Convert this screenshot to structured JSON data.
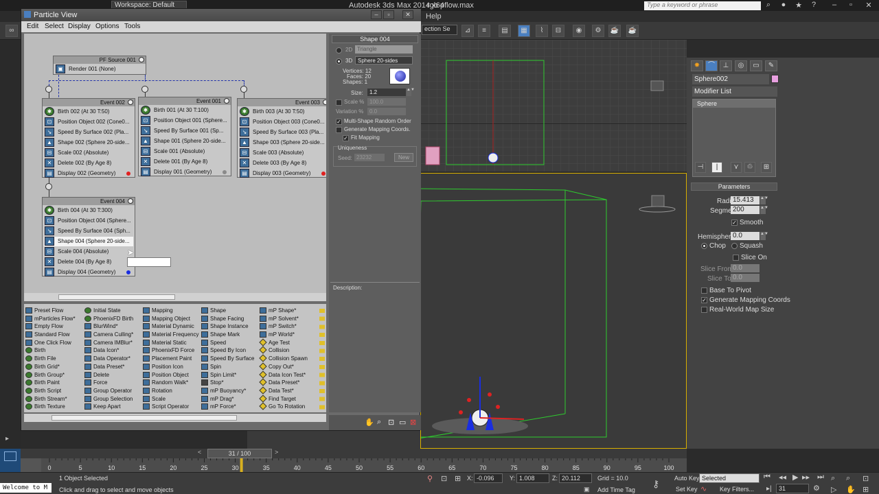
{
  "max": {
    "workspace": "Workspace: Default",
    "title": "Autodesk 3ds Max  2014 x64",
    "file": "rgb pflow.max",
    "search_placeholder": "Type a keyword or phrase",
    "help_menu": "Help",
    "selection_set": "ection Se"
  },
  "particle_view": {
    "title": "Particle View",
    "menu": [
      "Edit",
      "Select",
      "Display",
      "Options",
      "Tools"
    ],
    "source": {
      "title": "PF Source 001",
      "op": "Render 001 (None)"
    },
    "events": [
      {
        "title": "Event 002",
        "ops": [
          "Birth 002 (At 30 T:50)",
          "Position Object 002 (Cone0...",
          "Speed By Surface 002 (Pla...",
          "Shape 002 (Sphere 20-side...",
          "Scale 002 (Absolute)",
          "Delete 002 (By Age 8)",
          "Display 002 (Geometry)"
        ],
        "display_color": "#e02020"
      },
      {
        "title": "Event 001",
        "ops": [
          "Birth 001 (At 30 T:100)",
          "Position Object 001 (Sphere...",
          "Speed By Surface 001 (Sp...",
          "Shape 001 (Sphere 20-side...",
          "Scale 001 (Absolute)",
          "Delete 001 (By Age 8)",
          "Display 001 (Geometry)"
        ],
        "display_color": "#8a8a8a"
      },
      {
        "title": "Event 003",
        "ops": [
          "Birth 003 (At 30 T:50)",
          "Position Object 003 (Cone0...",
          "Speed By Surface 003 (Pla...",
          "Shape 003 (Sphere 20-side...",
          "Scale 003 (Absolute)",
          "Delete 003 (By Age 8)",
          "Display 003 (Geometry)"
        ],
        "display_color": "#e02020"
      },
      {
        "title": "Event 004",
        "ops": [
          "Birth 004 (At 30 T:300)",
          "Position Object 004 (Sphere...",
          "Speed By Surface 004 (Sph...",
          "Shape 004 (Sphere 20-side...",
          "Scale 004 (Absolute)",
          "Delete 004 (By Age 8)",
          "Display 004 (Geometry)"
        ],
        "display_color": "#1a2ee0"
      }
    ],
    "depot": [
      [
        "Preset Flow",
        "mParticles Flow*",
        "Empty Flow",
        "Standard Flow",
        "One Click Flow",
        "Birth",
        "Birth File",
        "Birth Grid*",
        "Birth Group*",
        "Birth Paint",
        "Birth Script",
        "Birth Stream*",
        "Birth Texture"
      ],
      [
        "Initial State",
        "PhoenixFD Birth",
        "BlurWind*",
        "Camera Culling*",
        "Camera IMBlur*",
        "Data Icon*",
        "Data Operator*",
        "Data Preset*",
        "Delete",
        "Force",
        "Group Operator",
        "Group Selection",
        "Keep Apart"
      ],
      [
        "Mapping",
        "Mapping Object",
        "Material Dynamic",
        "Material Frequency",
        "Material Static",
        "PhoenixFD Force",
        "Placement Paint",
        "Position Icon",
        "Position Object",
        "Random Walk*",
        "Rotation",
        "Scale",
        "Script Operator"
      ],
      [
        "Shape",
        "Shape Facing",
        "Shape Instance",
        "Shape Mark",
        "Speed",
        "Speed By Icon",
        "Speed By Surface",
        "Spin",
        "Spin Limit*",
        "Stop*",
        "mP Buoyancy*",
        "mP Drag*",
        "mP Force*"
      ],
      [
        "mP Shape*",
        "mP Solvent*",
        "mP Switch*",
        "mP World*",
        "Age Test",
        "Collision",
        "Collision Spawn",
        "Copy Out*",
        "Data Icon Test*",
        "Data Preset*",
        "Data Test*",
        "Find Target",
        "Go To Rotation"
      ]
    ],
    "params": {
      "title": "Shape 004",
      "opt2d": "2D",
      "val2d": "Triangle",
      "opt3d": "3D",
      "val3d": "Sphere 20-sides",
      "vertices": "Vertices: 12",
      "faces": "Faces: 20",
      "shapes": "Shapes: 1",
      "size_label": "Size:",
      "size": "1.2",
      "scale_label": "Scale %",
      "scale": "100.0",
      "variation_label": "Variation %",
      "variation": "0.0",
      "multi_shape": "Multi-Shape Random Order",
      "gen_mapping": "Generate Mapping Coords.",
      "fit_mapping": "Fit Mapping",
      "uniqueness": "Uniqueness",
      "seed_label": "Seed:",
      "seed": "23232",
      "new_btn": "New"
    },
    "description_label": "Description:"
  },
  "command_panel": {
    "object_name": "Sphere002",
    "modifier_list": "Modifier List",
    "stack_item": "Sphere",
    "params_title": "Parameters",
    "radius_label": "Radius:",
    "radius": "15.413",
    "segments_label": "Segments:",
    "segments": "200",
    "smooth": "Smooth",
    "hemisphere_label": "Hemisphere:",
    "hemisphere": "0.0",
    "chop": "Chop",
    "squash": "Squash",
    "slice_on": "Slice On",
    "slice_from_label": "Slice From:",
    "slice_from": "0.0",
    "slice_to_label": "Slice To:",
    "slice_to": "0.0",
    "base_to_pivot": "Base To Pivot",
    "gen_mapping": "Generate Mapping Coords",
    "real_world": "Real-World Map Size"
  },
  "timeline": {
    "frame": "31 / 100",
    "ticks": [
      "0",
      "5",
      "10",
      "15",
      "20",
      "25",
      "30",
      "35",
      "40",
      "45",
      "50",
      "55",
      "60",
      "65",
      "70",
      "75",
      "80",
      "85",
      "90",
      "95",
      "100"
    ]
  },
  "status": {
    "welcome": "Welcome to M",
    "selected": "1 Object Selected",
    "prompt": "Click and drag to select and move objects",
    "x_label": "X:",
    "x": "-0.096",
    "y_label": "Y:",
    "y": "1.008",
    "z_label": "Z:",
    "z": "20.112",
    "grid": "Grid = 10.0",
    "add_time_tag": "Add Time Tag",
    "auto_key": "Auto Key",
    "auto_key_value": "Selected",
    "set_key": "Set Key",
    "key_filters": "Key Filters...",
    "current_frame": "31"
  }
}
